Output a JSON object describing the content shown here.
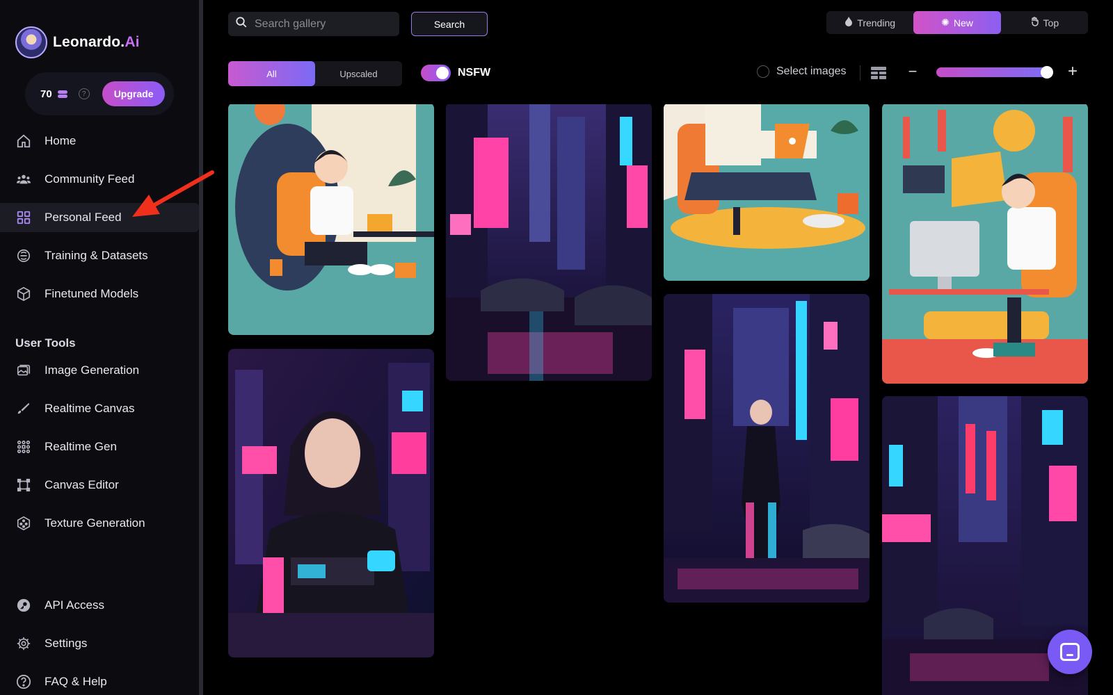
{
  "brand": {
    "name": "Leonardo.",
    "suffix": "Ai"
  },
  "credits": {
    "count": "70",
    "upgrade_label": "Upgrade"
  },
  "nav": {
    "main": [
      {
        "label": "Home",
        "icon": "home-icon"
      },
      {
        "label": "Community Feed",
        "icon": "community-icon"
      },
      {
        "label": "Personal Feed",
        "icon": "grid-icon",
        "active": true
      },
      {
        "label": "Training & Datasets",
        "icon": "training-icon"
      },
      {
        "label": "Finetuned Models",
        "icon": "cube-icon"
      }
    ],
    "section_label": "User Tools",
    "tools": [
      {
        "label": "Image Generation",
        "icon": "image-gen-icon"
      },
      {
        "label": "Realtime Canvas",
        "icon": "realtime-canvas-icon"
      },
      {
        "label": "Realtime Gen",
        "icon": "realtime-gen-icon"
      },
      {
        "label": "Canvas Editor",
        "icon": "canvas-editor-icon"
      },
      {
        "label": "Texture Generation",
        "icon": "texture-icon"
      }
    ],
    "bottom": [
      {
        "label": "API Access",
        "icon": "key-icon"
      },
      {
        "label": "Settings",
        "icon": "gear-icon"
      },
      {
        "label": "FAQ & Help",
        "icon": "help-icon"
      }
    ]
  },
  "search": {
    "placeholder": "Search gallery",
    "button_label": "Search"
  },
  "sort": [
    {
      "label": "Trending",
      "icon": "flame-icon",
      "active": false
    },
    {
      "label": "New",
      "icon": "sparkle-icon",
      "active": true
    },
    {
      "label": "Top",
      "icon": "hand-icon",
      "active": false
    }
  ],
  "filter": {
    "all_label": "All",
    "upscaled_label": "Upscaled",
    "selected": "All"
  },
  "nsfw": {
    "label": "NSFW",
    "enabled": true
  },
  "select_images_label": "Select images",
  "zoom_level": 0.95,
  "colors": {
    "accent_pink": "#c64dc9",
    "accent_violet": "#8b5cf6",
    "annotation_red": "#f0301c"
  }
}
